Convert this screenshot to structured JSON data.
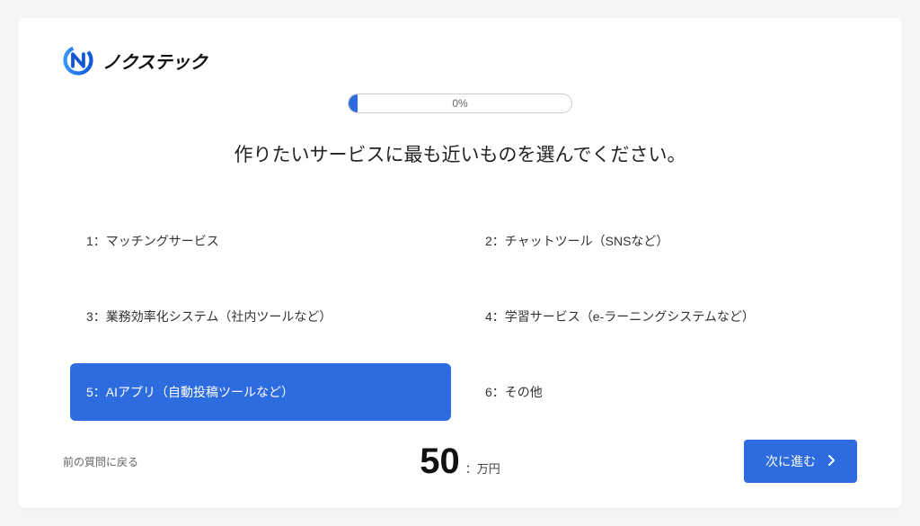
{
  "logo_text": "ノクステック",
  "progress": {
    "percent_label": "0%"
  },
  "question": "作りたいサービスに最も近いものを選んでください。",
  "options": [
    {
      "label": "1：マッチングサービス",
      "selected": false
    },
    {
      "label": "2：チャットツール（SNSなど）",
      "selected": false
    },
    {
      "label": "3：業務効率化システム（社内ツールなど）",
      "selected": false
    },
    {
      "label": "4：学習サービス（e-ラーニングシステムなど）",
      "selected": false
    },
    {
      "label": "5：AIアプリ（自動投稿ツールなど）",
      "selected": true
    },
    {
      "label": "6：その他",
      "selected": false
    }
  ],
  "footer": {
    "back_label": "前の質問に戻る",
    "price_number": "50",
    "price_unit": "：万円",
    "next_label": "次に進む"
  }
}
